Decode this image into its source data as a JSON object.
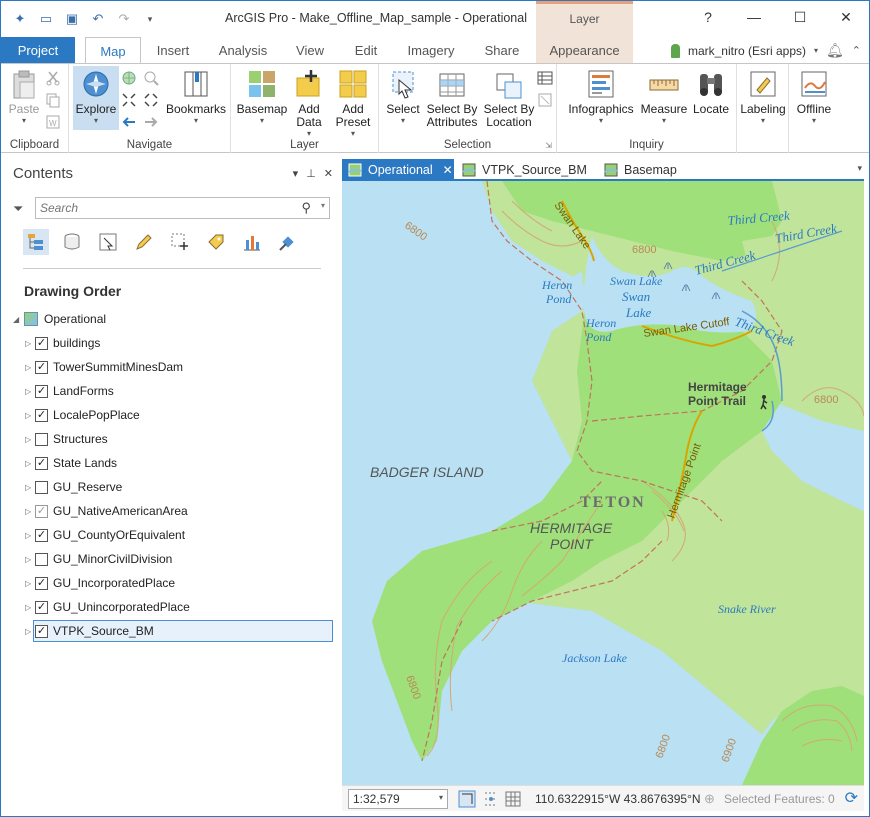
{
  "app": {
    "title": "ArcGIS Pro - Make_Offline_Map_sample - Operational",
    "context_tab_group": "Layer",
    "help": "?",
    "user": "mark_nitro (Esri apps)"
  },
  "tabs": [
    "Project",
    "Map",
    "Insert",
    "Analysis",
    "View",
    "Edit",
    "Imagery",
    "Share",
    "Appearance"
  ],
  "ribbon": {
    "clipboard": {
      "label": "Clipboard",
      "paste": "Paste"
    },
    "navigate": {
      "label": "Navigate",
      "explore": "Explore",
      "bookmarks": "Bookmarks"
    },
    "layer": {
      "label": "Layer",
      "basemap": "Basemap",
      "add_data": "Add\nData",
      "add_preset": "Add\nPreset"
    },
    "selection": {
      "label": "Selection",
      "select": "Select",
      "select_by_attributes": "Select By\nAttributes",
      "select_by_location": "Select By\nLocation"
    },
    "inquiry": {
      "label": "Inquiry",
      "infographics": "Infographics",
      "measure": "Measure",
      "locate": "Locate"
    },
    "labeling": {
      "label": "Labeling"
    },
    "offline": {
      "label": "Offline"
    }
  },
  "contents": {
    "title": "Contents",
    "search_placeholder": "Search",
    "drawing_order": "Drawing Order",
    "root": "Operational",
    "layers": [
      {
        "name": "buildings",
        "checked": true
      },
      {
        "name": "TowerSummitMinesDam",
        "checked": true
      },
      {
        "name": "LandForms",
        "checked": true
      },
      {
        "name": "LocalePopPlace",
        "checked": true
      },
      {
        "name": "Structures",
        "checked": false
      },
      {
        "name": "State Lands",
        "checked": true
      },
      {
        "name": "GU_Reserve",
        "checked": false
      },
      {
        "name": "GU_NativeAmericanArea",
        "checked": true
      },
      {
        "name": "GU_CountyOrEquivalent",
        "checked": true
      },
      {
        "name": "GU_MinorCivilDivision",
        "checked": false
      },
      {
        "name": "GU_IncorporatedPlace",
        "checked": true
      },
      {
        "name": "GU_UnincorporatedPlace",
        "checked": true
      },
      {
        "name": "VTPK_Source_BM",
        "checked": true
      }
    ]
  },
  "map_tabs": [
    "Operational",
    "VTPK_Source_BM",
    "Basemap"
  ],
  "map_labels": {
    "swan_lake_top": "Swan Lake",
    "third_creek_1": "Third Creek",
    "third_creek_2": "Third Creek",
    "third_creek_3": "Third Creek",
    "third_creek_4": "Third Creek",
    "heron_pond_1": "Heron\nPond",
    "heron_pond_2": "Heron\nPond",
    "swan_lake_1": "Swan Lake",
    "swan_lake_2": "Swan\nLake",
    "swan_lake_cutoff": "Swan Lake Cutoff",
    "hermitage_trail": "Hermitage\nPoint Trail",
    "badger_island": "BADGER ISLAND",
    "teton": "TETON",
    "hermitage_point": "HERMITAGE\nPOINT",
    "hermitage_point_road": "Hermitage Point",
    "snake_river": "Snake River",
    "jackson_lake": "Jackson Lake",
    "contour_6800_a": "6800",
    "contour_6800_b": "6800",
    "contour_6800_c": "6800",
    "contour_6800_d": "6800",
    "contour_6800_e": "6800",
    "contour_6900": "6900"
  },
  "status": {
    "scale": "1:32,579",
    "coordinates": "110.6322915°W 43.8676395°N",
    "selected_features": "Selected Features: 0"
  }
}
